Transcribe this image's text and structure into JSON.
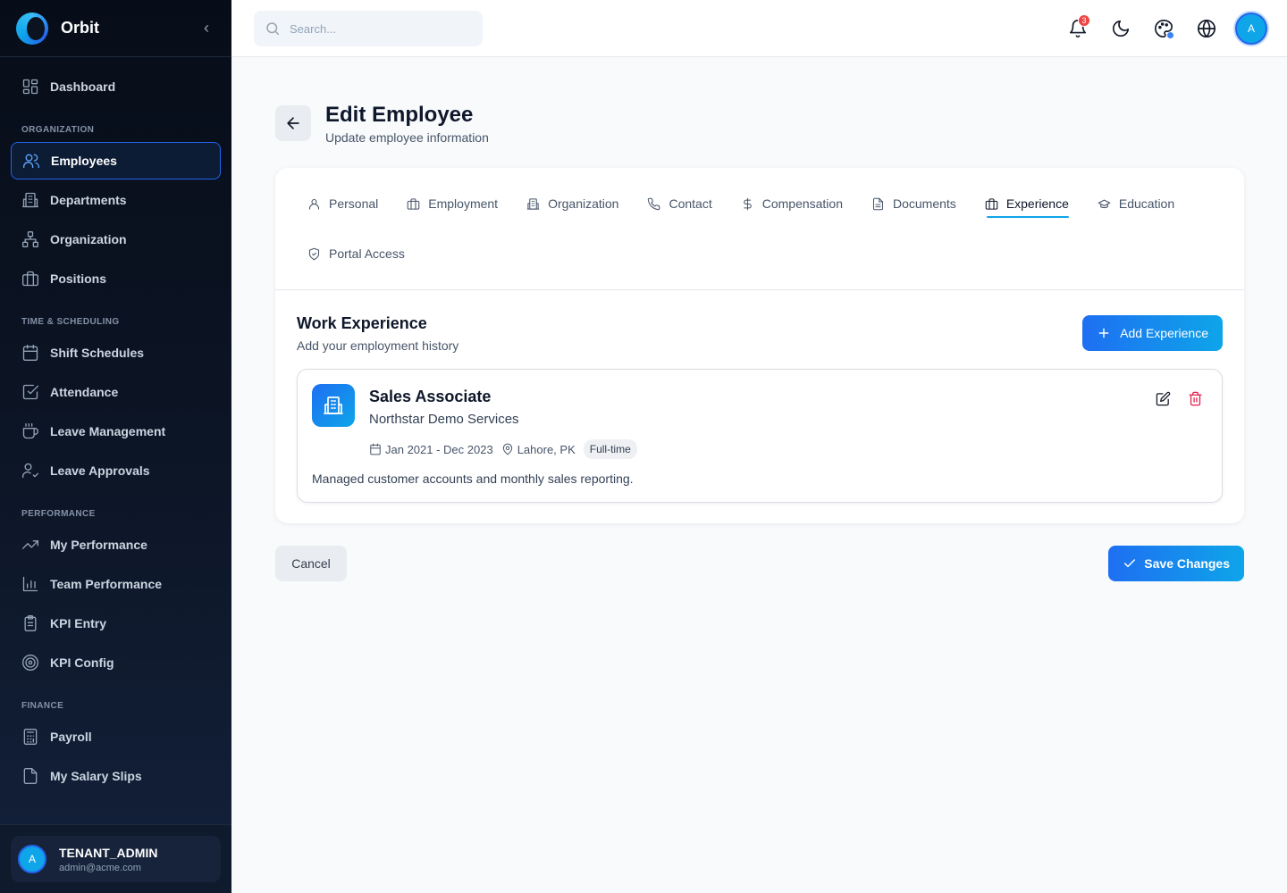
{
  "app": {
    "name": "Orbit"
  },
  "sidebar": {
    "dashboard": {
      "label": "Dashboard",
      "icon": "dashboard-icon"
    },
    "sections": [
      {
        "title": "ORGANIZATION",
        "items": [
          {
            "label": "Employees",
            "icon": "users-icon",
            "active": true
          },
          {
            "label": "Departments",
            "icon": "building-icon"
          },
          {
            "label": "Organization",
            "icon": "org-chart-icon"
          },
          {
            "label": "Positions",
            "icon": "briefcase-icon"
          }
        ]
      },
      {
        "title": "TIME & SCHEDULING",
        "items": [
          {
            "label": "Shift Schedules",
            "icon": "calendar-icon"
          },
          {
            "label": "Attendance",
            "icon": "check-square-icon"
          },
          {
            "label": "Leave Management",
            "icon": "coffee-icon"
          },
          {
            "label": "Leave Approvals",
            "icon": "user-check-icon"
          }
        ]
      },
      {
        "title": "PERFORMANCE",
        "items": [
          {
            "label": "My Performance",
            "icon": "trending-up-icon"
          },
          {
            "label": "Team Performance",
            "icon": "bar-chart-icon"
          },
          {
            "label": "KPI Entry",
            "icon": "clipboard-icon"
          },
          {
            "label": "KPI Config",
            "icon": "target-icon"
          }
        ]
      },
      {
        "title": "FINANCE",
        "items": [
          {
            "label": "Payroll",
            "icon": "calculator-icon"
          },
          {
            "label": "My Salary Slips",
            "icon": "file-icon"
          }
        ]
      }
    ],
    "user": {
      "initial": "A",
      "name": "TENANT_ADMIN",
      "email": "admin@acme.com"
    }
  },
  "topbar": {
    "search_placeholder": "Search...",
    "notification_count": "3",
    "avatar_initial": "A"
  },
  "page": {
    "title": "Edit Employee",
    "subtitle": "Update employee information"
  },
  "tabs": [
    {
      "label": "Personal",
      "icon": "user-icon"
    },
    {
      "label": "Employment",
      "icon": "briefcase-icon"
    },
    {
      "label": "Organization",
      "icon": "building-icon"
    },
    {
      "label": "Contact",
      "icon": "phone-icon"
    },
    {
      "label": "Compensation",
      "icon": "dollar-icon"
    },
    {
      "label": "Documents",
      "icon": "document-icon"
    },
    {
      "label": "Experience",
      "icon": "briefcase-icon",
      "active": true
    },
    {
      "label": "Education",
      "icon": "graduation-cap-icon"
    },
    {
      "label": "Portal Access",
      "icon": "shield-icon"
    }
  ],
  "experience": {
    "section_title": "Work Experience",
    "section_subtitle": "Add your employment history",
    "add_label": "Add Experience",
    "items": [
      {
        "role": "Sales Associate",
        "company": "Northstar Demo Services",
        "period": "Jan 2021 - Dec 2023",
        "location": "Lahore, PK",
        "type": "Full-time",
        "description": "Managed customer accounts and monthly sales reporting."
      }
    ]
  },
  "actions": {
    "cancel_label": "Cancel",
    "save_label": "Save Changes"
  },
  "colors": {
    "accent": "#1e6ff2",
    "accent_2": "#0ea5e9",
    "danger": "#e11d48",
    "sidebar_bg": "#0d1627"
  }
}
